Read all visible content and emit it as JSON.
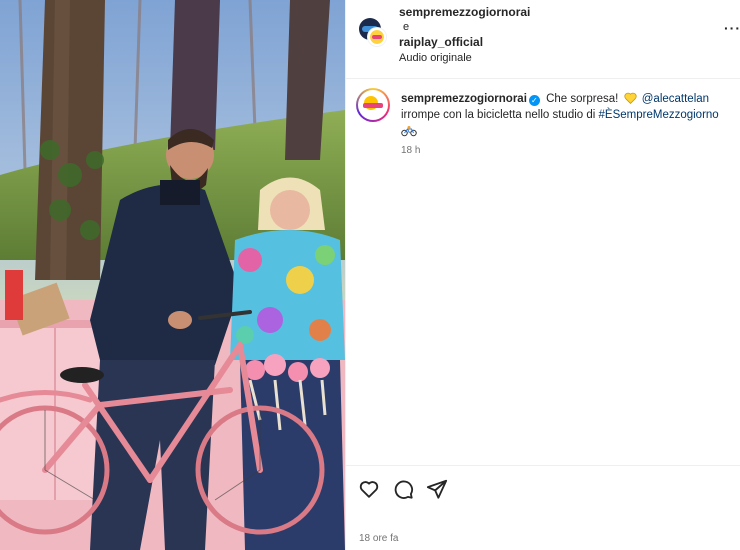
{
  "post": {
    "header": {
      "username_1": "sempremezzogiornorai",
      "joiner": "e",
      "username_2": "raiplay_official",
      "audio": "Audio originale",
      "more_icon": "more-dots-icon"
    },
    "caption": {
      "username": "sempremezzogiornorai",
      "verified_icon": "verified-badge-icon",
      "text_1": "Che sorpresa!",
      "heart_icon": "yellow-heart-icon",
      "mention": "@alecattelan",
      "text_2": "irrompe con la bicicletta nello studio di",
      "hashtag": "#ÈSempreMezzogiorno",
      "bike_icon": "bicycle-emoji-icon",
      "time": "18 h"
    },
    "actions": {
      "like_icon": "heart-icon",
      "comment_icon": "comment-icon",
      "share_icon": "share-icon"
    },
    "timestamp": "18 ore fa"
  },
  "colors": {
    "verified": "#0095f6",
    "link": "#00376b",
    "secondary_text": "#737373",
    "bike": "#e58a96"
  }
}
